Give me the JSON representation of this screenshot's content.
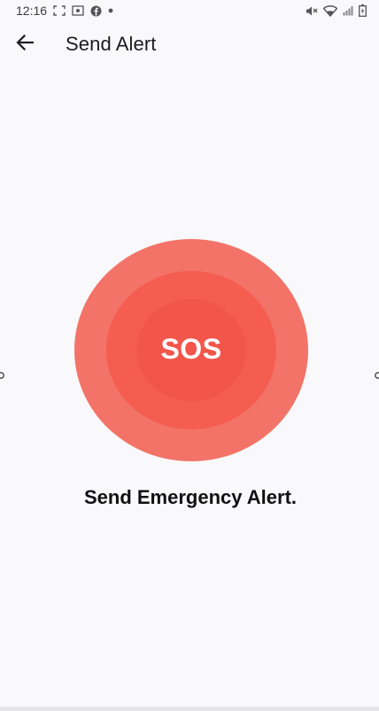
{
  "status_bar": {
    "time": "12:16",
    "left_icons": [
      "screenshot-icon",
      "scan-icon",
      "facebook-icon",
      "dot-icon"
    ],
    "right_icons": [
      "mute-icon",
      "wifi-icon",
      "signal-icon",
      "battery-icon"
    ]
  },
  "app_bar": {
    "back_icon": "arrow-left-icon",
    "title": "Send Alert"
  },
  "sos": {
    "label": "SOS",
    "colors": {
      "outer": "#f37368",
      "middle": "#f45d50",
      "inner": "#f2564b"
    }
  },
  "subtitle": "Send Emergency Alert."
}
